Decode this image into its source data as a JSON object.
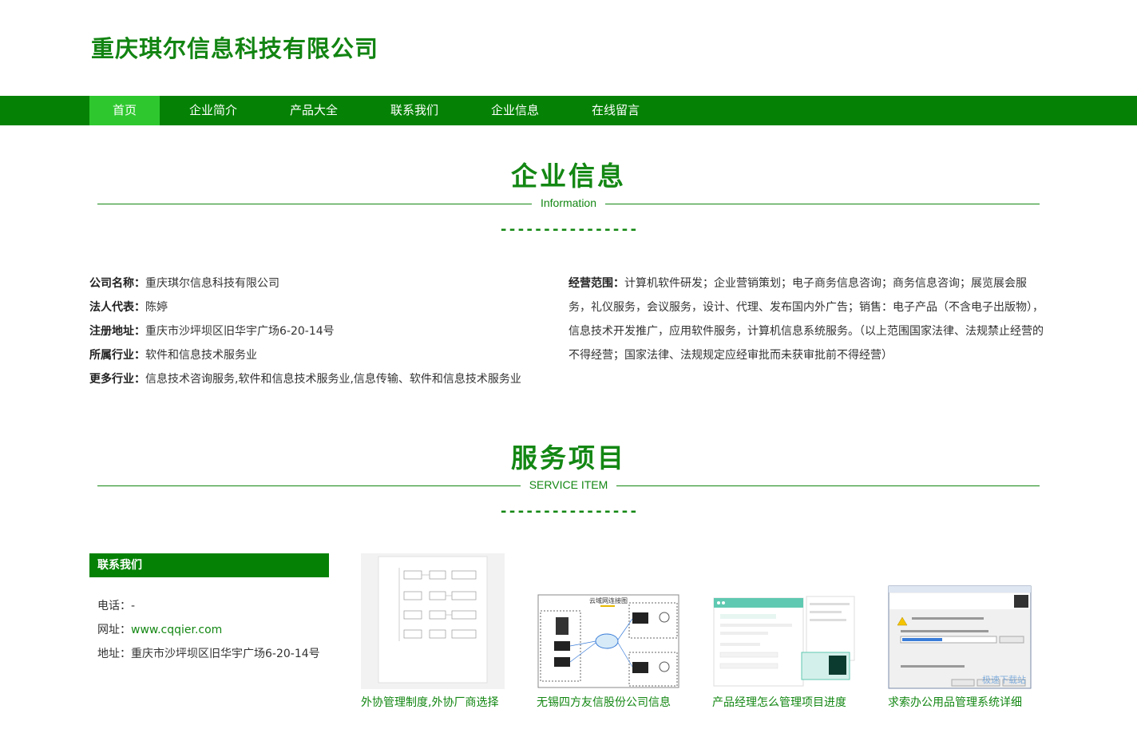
{
  "header": {
    "title": "重庆琪尔信息科技有限公司"
  },
  "nav": {
    "items": [
      {
        "label": "首页"
      },
      {
        "label": "企业简介"
      },
      {
        "label": "产品大全"
      },
      {
        "label": "联系我们"
      },
      {
        "label": "企业信息"
      },
      {
        "label": "在线留言"
      }
    ]
  },
  "company_section": {
    "title": "企业信息",
    "subtitle": "Information",
    "divider": "----------------",
    "fields": [
      {
        "label": "公司名称：",
        "value": "重庆琪尔信息科技有限公司"
      },
      {
        "label": "法人代表：",
        "value": "陈婷"
      },
      {
        "label": "注册地址：",
        "value": "重庆市沙坪坝区旧华宇广场6-20-14号"
      },
      {
        "label": "所属行业：",
        "value": "软件和信息技术服务业"
      },
      {
        "label": "更多行业：",
        "value": "信息技术咨询服务,软件和信息技术服务业,信息传输、软件和信息技术服务业"
      }
    ],
    "scope": {
      "label": "经营范围：",
      "value": "计算机软件研发；企业营销策划；电子商务信息咨询；商务信息咨询；展览展会服务，礼仪服务，会议服务，设计、代理、发布国内外广告；销售：电子产品（不含电子出版物），信息技术开发推广，应用软件服务，计算机信息系统服务。（以上范围国家法律、法规禁止经营的不得经营；国家法律、法规规定应经审批而未获审批前不得经营）"
    }
  },
  "service_section": {
    "title": "服务项目",
    "subtitle": "SERVICE ITEM",
    "divider": "----------------"
  },
  "contact": {
    "title": "联系我们",
    "phone_label": "电话：",
    "phone": "-",
    "site_label": "网址：",
    "site": "www.cqqier.com",
    "address_label": "地址：",
    "address": "重庆市沙坪坝区旧华宇广场6-20-14号"
  },
  "products": [
    {
      "caption": "外协管理制度,外协厂商选择",
      "thumb_icon": "flowchart-document-icon"
    },
    {
      "caption": "无锡四方友信股份公司信息",
      "thumb_icon": "network-diagram-icon",
      "thumb_text": "云域网连接图"
    },
    {
      "caption": "产品经理怎么管理项目进度",
      "thumb_icon": "app-screenshot-icon"
    },
    {
      "caption": "求索办公用品管理系统详细",
      "thumb_icon": "installer-window-icon",
      "thumb_text": "极速下载站"
    }
  ],
  "colors": {
    "brand": "#058205",
    "accent": "#2ec82e",
    "text_green": "#138713"
  }
}
